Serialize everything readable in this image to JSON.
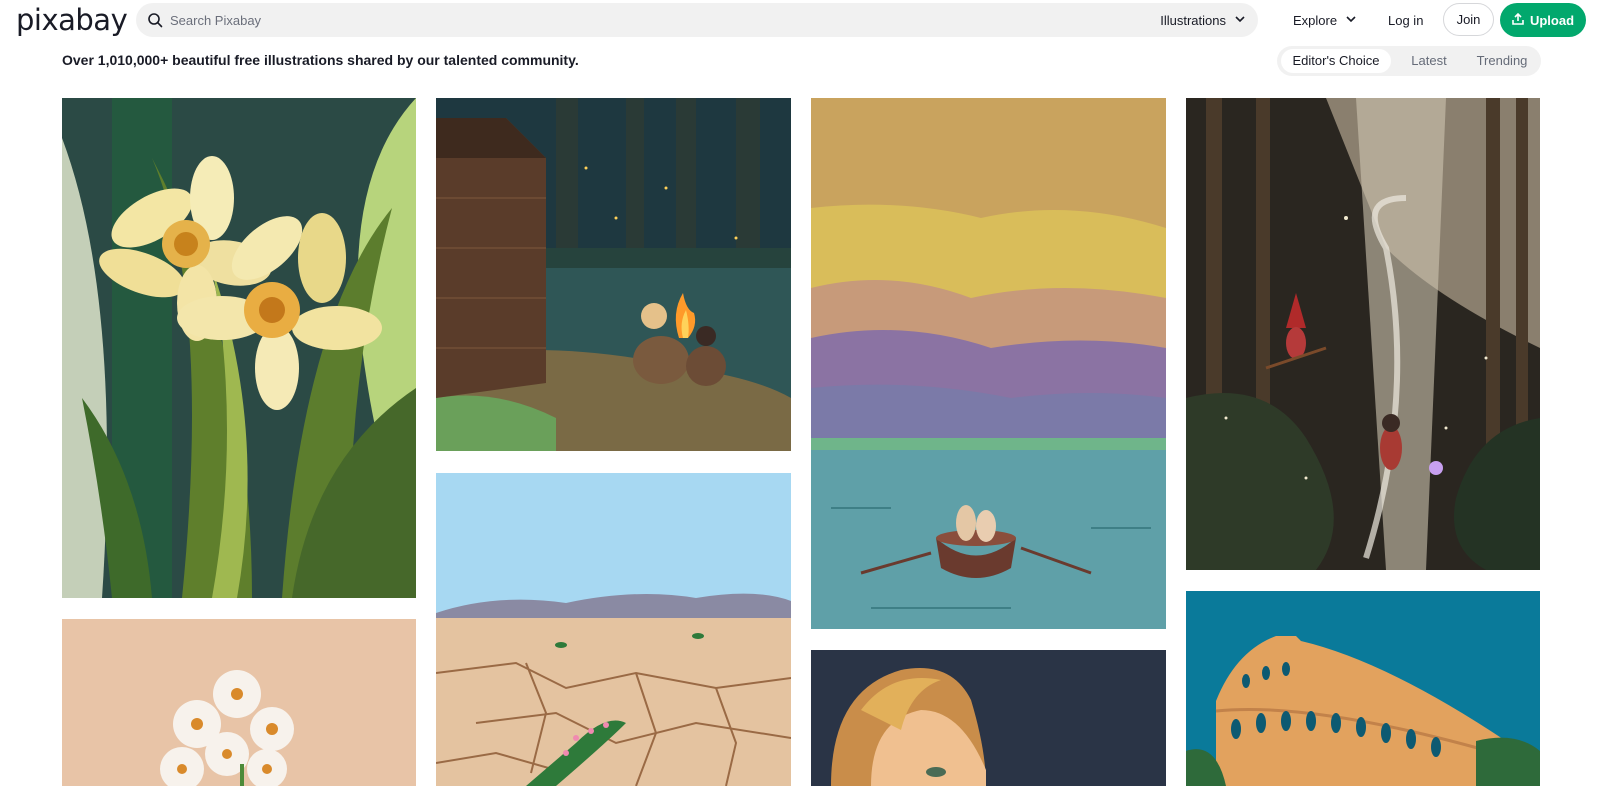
{
  "header": {
    "logo": "pixabay",
    "search": {
      "placeholder": "Search Pixabay",
      "type_label": "Illustrations"
    },
    "explore_label": "Explore",
    "login_label": "Log in",
    "join_label": "Join",
    "upload_label": "Upload"
  },
  "tagline": "Over 1,010,000+ beautiful free illustrations shared by our talented community.",
  "tabs": [
    {
      "label": "Editor's Choice",
      "active": true
    },
    {
      "label": "Latest",
      "active": false
    },
    {
      "label": "Trending",
      "active": false
    }
  ],
  "colors": {
    "brand_green": "#02a86d",
    "search_bg": "#f1f1f1"
  },
  "gallery": [
    {
      "subject": "daffodils"
    },
    {
      "subject": "white-flowers"
    },
    {
      "subject": "campfire"
    },
    {
      "subject": "dry-desert"
    },
    {
      "subject": "rowboat-lake"
    },
    {
      "subject": "woman-portrait"
    },
    {
      "subject": "witch-forest"
    },
    {
      "subject": "colosseum"
    }
  ]
}
